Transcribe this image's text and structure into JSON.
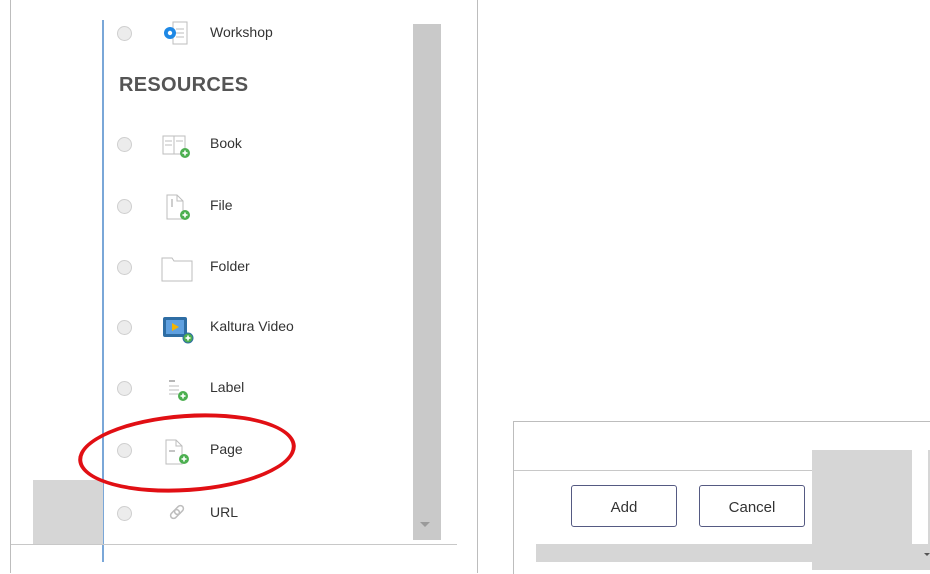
{
  "activities": {
    "workshop_label": "Workshop"
  },
  "resources": {
    "heading": "RESOURCES",
    "items": [
      {
        "label": "Book"
      },
      {
        "label": "File"
      },
      {
        "label": "Folder"
      },
      {
        "label": "Kaltura Video"
      },
      {
        "label": "Label"
      },
      {
        "label": "Page"
      },
      {
        "label": "URL"
      }
    ]
  },
  "footer": {
    "add_label": "Add",
    "cancel_label": "Cancel"
  },
  "colors": {
    "highlight": "#e10f14",
    "plus_green": "#4caf50",
    "workshop_blue": "#1e88e5"
  }
}
